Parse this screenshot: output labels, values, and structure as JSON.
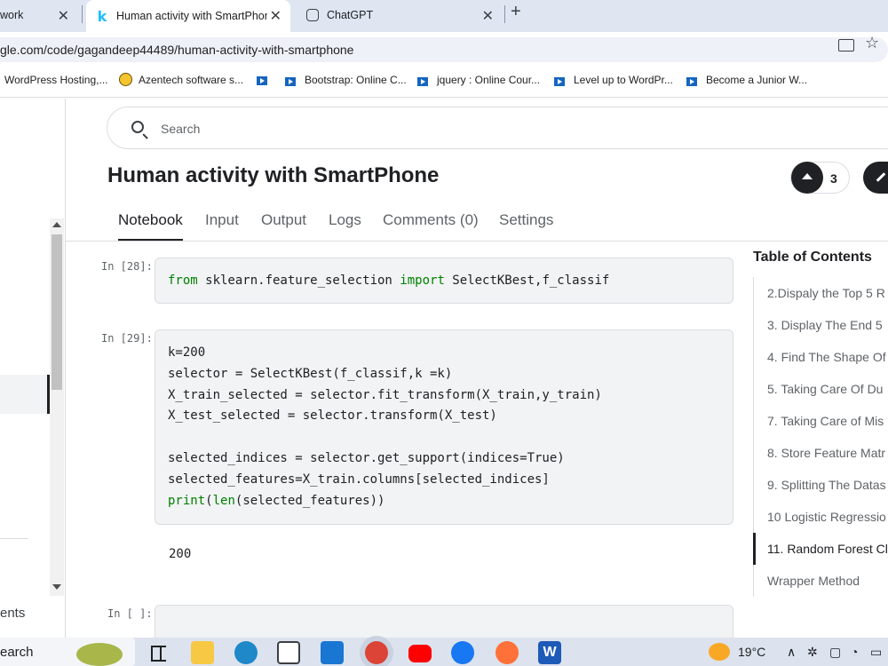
{
  "browser": {
    "tabs": [
      {
        "label": "work",
        "icon": "partial-tab-icon"
      },
      {
        "label": "Human activity with SmartPhon",
        "icon": "kaggle-icon",
        "favicon_text": "k",
        "active": true
      },
      {
        "label": "ChatGPT",
        "icon": "chatgpt-icon"
      }
    ],
    "close_glyph": "✕",
    "new_tab_glyph": "+",
    "url": "gle.com/code/gagandeep44489/human-activity-with-smartphone",
    "star_glyph": "☆",
    "bookmarks": [
      {
        "label": "WordPress Hosting,...",
        "icon": "none"
      },
      {
        "label": "Azentech software s...",
        "icon": "azentech-logo-icon"
      },
      {
        "label": "",
        "icon": "video-bookmark-icon"
      },
      {
        "label": "Bootstrap: Online C...",
        "icon": "video-bookmark-icon"
      },
      {
        "label": "jquery : Online Cour...",
        "icon": "video-bookmark-icon"
      },
      {
        "label": "Level up to WordPr...",
        "icon": "video-bookmark-icon"
      },
      {
        "label": "Become a Junior W...",
        "icon": "video-bookmark-icon"
      }
    ]
  },
  "sidebar": {
    "bottom_label": "ents"
  },
  "search": {
    "placeholder": "Search"
  },
  "notebook": {
    "title": "Human activity with SmartPhone",
    "upvote_count": "3",
    "tabs": [
      "Notebook",
      "Input",
      "Output",
      "Logs",
      "Comments (0)",
      "Settings"
    ],
    "active_tab": "Notebook",
    "cells": [
      {
        "prompt": "In [28]:",
        "code": [
          "from sklearn.feature_selection import SelectKBest,f_classif"
        ]
      },
      {
        "prompt": "In [29]:",
        "code": [
          "k=200",
          "selector = SelectKBest(f_classif,k =k)",
          "X_train_selected = selector.fit_transform(X_train,y_train)",
          "X_test_selected = selector.transform(X_test)",
          "",
          "selected_indices = selector.get_support(indices=True)",
          "selected_features=X_train.columns[selected_indices]",
          "print(len(selected_features))"
        ],
        "output": "200"
      },
      {
        "prompt": "In [ ]:",
        "code": []
      }
    ]
  },
  "toc": {
    "title": "Table of Contents",
    "items": [
      "2.Dispaly the Top 5 R",
      "3. Display The End 5",
      "4. Find The Shape Of",
      "5. Taking Care Of Du",
      "7. Taking Care of Mis",
      "8. Store Feature Matr",
      "9. Splitting The Datas",
      "10 Logistic Regressio",
      "11. Random Forest Cl",
      "Wrapper Method"
    ],
    "active_index": 8
  },
  "taskbar": {
    "search_label": "earch",
    "weather": "19°C",
    "apps": [
      "task-view-icon",
      "file-explorer-icon",
      "edge-icon",
      "store-icon",
      "mail-icon",
      "chrome-icon",
      "youtube-icon",
      "facebook-icon",
      "firefox-icon",
      "word-icon"
    ],
    "word_letter": "W"
  }
}
